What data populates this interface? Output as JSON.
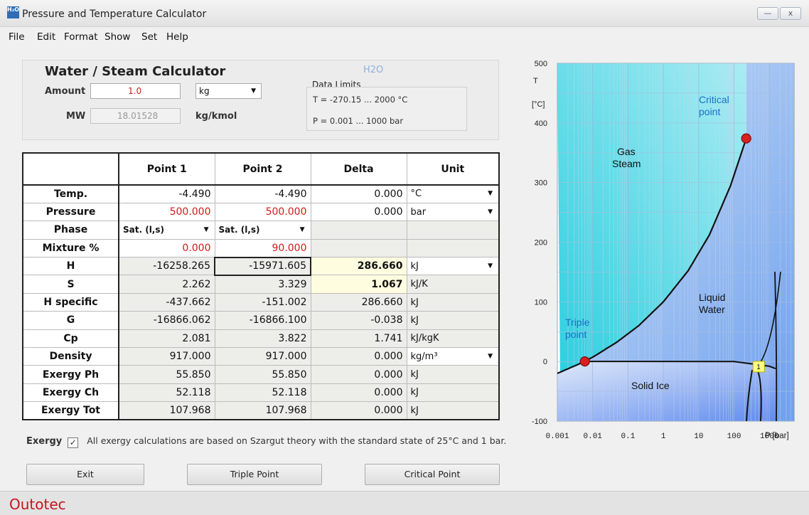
{
  "window": {
    "title": "Pressure and Temperature Calculator",
    "icon_text": "H₂O",
    "minimize": "—",
    "close": "x"
  },
  "menu": [
    "File",
    "Edit",
    "Format",
    "Show",
    "Set",
    "Help"
  ],
  "calc": {
    "title": "Water / Steam Calculator",
    "species": "H2O",
    "amount_label": "Amount",
    "amount_value": "1.0",
    "amount_unit": "kg",
    "mw_label": "MW",
    "mw_value": "18.01528",
    "mw_unit": "kg/kmol",
    "limits_title": "Data Limits",
    "limits_t": "T = -270.15 ... 2000 °C",
    "limits_p": "P = 0.001 ... 1000 bar"
  },
  "table": {
    "headers": [
      "",
      "Point 1",
      "Point 2",
      "Delta",
      "Unit"
    ],
    "rows": [
      {
        "label": "Temp.",
        "p1": "-4.490",
        "p2": "-4.490",
        "delta": "0.000",
        "unit": "°C",
        "unit_dropdown": true
      },
      {
        "label": "Pressure",
        "p1": "500.000",
        "p2": "500.000",
        "delta": "0.000",
        "unit": "bar",
        "unit_dropdown": true
      },
      {
        "label": "Phase",
        "p1": "Sat. (l,s)",
        "p2": "Sat. (l,s)",
        "delta": "",
        "unit": ""
      },
      {
        "label": "Mixture %",
        "p1": "0.000",
        "p2": "90.000",
        "delta": "",
        "unit": ""
      },
      {
        "label": "H",
        "p1": "-16258.265",
        "p2": "-15971.605",
        "delta": "286.660",
        "unit": "kJ",
        "unit_dropdown": true
      },
      {
        "label": "S",
        "p1": "2.262",
        "p2": "3.329",
        "delta": "1.067",
        "unit": "kJ/K"
      },
      {
        "label": "H specific",
        "p1": "-437.662",
        "p2": "-151.002",
        "delta": "286.660",
        "unit": "kJ"
      },
      {
        "label": "G",
        "p1": "-16866.062",
        "p2": "-16866.100",
        "delta": "-0.038",
        "unit": "kJ"
      },
      {
        "label": "Cp",
        "p1": "2.081",
        "p2": "3.822",
        "delta": "1.741",
        "unit": "kJ/kgK"
      },
      {
        "label": "Density",
        "p1": "917.000",
        "p2": "917.000",
        "delta": "0.000",
        "unit": "kg/m³",
        "unit_dropdown": true
      },
      {
        "label": "Exergy Ph",
        "p1": "55.850",
        "p2": "55.850",
        "delta": "0.000",
        "unit": "kJ"
      },
      {
        "label": "Exergy Ch",
        "p1": "52.118",
        "p2": "52.118",
        "delta": "0.000",
        "unit": "kJ"
      },
      {
        "label": "Exergy Tot",
        "p1": "107.968",
        "p2": "107.968",
        "delta": "0.000",
        "unit": "kJ"
      }
    ]
  },
  "exergy": {
    "label": "Exergy",
    "checked": true,
    "check_glyph": "✓",
    "note": "All exergy calculations are based on Szargut theory with the standard state of 25°C and 1 bar."
  },
  "buttons": {
    "exit": "Exit",
    "triple": "Triple Point",
    "critical": "Critical Point"
  },
  "brand": "Outotec",
  "colors": {
    "accent_red": "#d01a1a",
    "brand_red": "#c4161c",
    "gas_region": "#37d3e3",
    "liquid_region": "#a8cdf5",
    "ice_region": "#c6d8f6",
    "point_marker": "#d9201f",
    "marker_label_bg": "#ffff80"
  },
  "phase_diagram": {
    "type": "line",
    "x_scale": "log",
    "xlim": [
      0.001,
      5000
    ],
    "ylim": [
      -100,
      500
    ],
    "x_ticks": [
      "0.001",
      "0.01",
      "0.1",
      "1",
      "10",
      "100",
      "1000"
    ],
    "x_tick_values": [
      0.001,
      0.01,
      0.1,
      1,
      10,
      100,
      1000
    ],
    "y_ticks": [
      "500",
      "400",
      "300",
      "200",
      "100",
      "0",
      "-100"
    ],
    "y_tick_values": [
      500,
      400,
      300,
      200,
      100,
      0,
      -100
    ],
    "ylabel_lines": [
      "T",
      "[°C]"
    ],
    "xlabel": "P [bar]",
    "region_labels": {
      "gas": [
        "Gas",
        "Steam"
      ],
      "liquid": [
        "Liquid",
        "Water"
      ],
      "ice": "Solid Ice",
      "triple": [
        "Triple",
        "point"
      ],
      "critical": [
        "Critical",
        "point"
      ]
    },
    "marker_label": "1",
    "saturation_curve": {
      "x": [
        0.001,
        0.006,
        0.012,
        0.05,
        0.2,
        1,
        5,
        20,
        80,
        221
      ],
      "y": [
        -20,
        0.01,
        10,
        33,
        60,
        100,
        152,
        212,
        295,
        374
      ]
    },
    "melting_line": {
      "x": [
        0.006,
        100,
        1000,
        1500
      ],
      "y": [
        0.01,
        0,
        -8,
        -12
      ]
    },
    "points": [
      {
        "name": "Triple point",
        "x": 0.006,
        "y": 0.01
      },
      {
        "name": "Critical point",
        "x": 221,
        "y": 374
      },
      {
        "name": "1",
        "x": 500,
        "y": -4.49
      }
    ]
  }
}
